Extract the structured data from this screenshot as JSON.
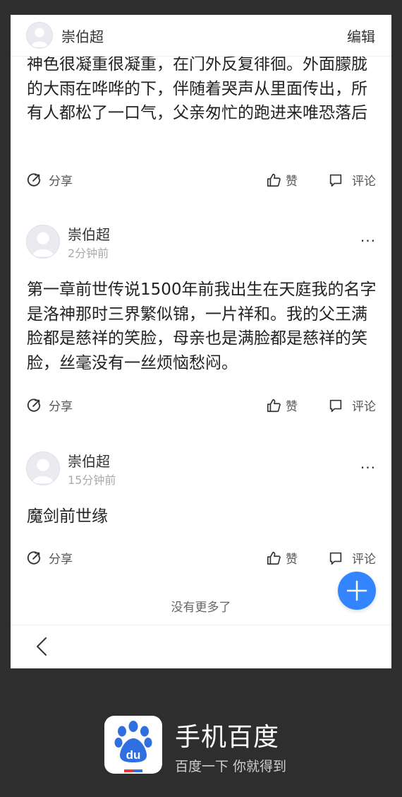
{
  "header": {
    "username": "崇伯超",
    "edit_label": "编辑"
  },
  "posts": [
    {
      "text": "神色很凝重很凝重，在门外反复徘徊。外面朦胧的大雨在哗哗的下，伴随着哭声从里面传出，所有人都松了一口气，父亲匆忙的跑进来唯恐落后"
    },
    {
      "username": "崇伯超",
      "time": "2分钟前",
      "text": "第一章前世传说1500年前我出生在天庭我的名字是洛神那时三界繁似锦，一片祥和。我的父王满脸都是慈祥的笑脸，母亲也是满脸都是慈祥的笑脸，丝毫没有一丝烦恼愁闷。"
    },
    {
      "username": "崇伯超",
      "time": "15分钟前",
      "text": "魔剑前世缘"
    }
  ],
  "actions": {
    "share": "分享",
    "like": "赞",
    "comment": "评论",
    "more": "···"
  },
  "footer": {
    "no_more": "没有更多了"
  },
  "brand": {
    "title": "手机百度",
    "subtitle": "百度一下 你就得到",
    "logo_text": "du"
  },
  "colors": {
    "accent": "#3385ff",
    "background": "#2e2e2e",
    "card": "#ffffff"
  }
}
